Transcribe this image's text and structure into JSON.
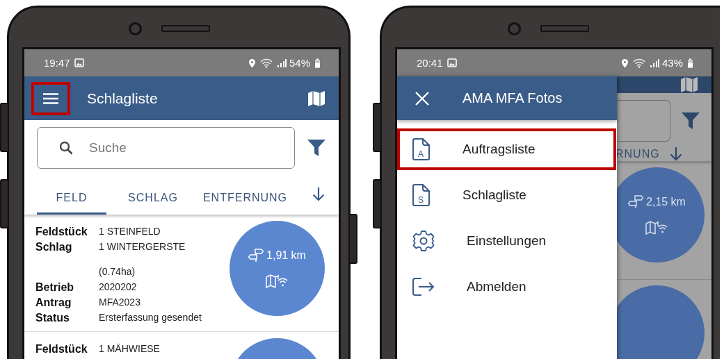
{
  "phones": [
    {
      "kind": "list",
      "status_bar": {
        "time": "19:47",
        "battery": "54%"
      },
      "app_bar": {
        "title": "Schlagliste",
        "menu_highlighted": true
      },
      "search": {
        "placeholder": "Suche"
      },
      "tabs": [
        {
          "label": "FELD",
          "selected": true
        },
        {
          "label": "SCHLAG",
          "selected": false
        },
        {
          "label": "ENTFERNUNG",
          "selected": false
        }
      ],
      "rows": [
        {
          "fields": [
            {
              "kind": "field",
              "label": "Feldstück",
              "value": "1 STEINFELD"
            },
            {
              "kind": "field",
              "label": "Schlag",
              "value": "1 WINTERGERSTE"
            },
            {
              "kind": "area",
              "value": "(0.74ha)"
            },
            {
              "kind": "field",
              "label": "Betrieb",
              "value": "2020202"
            },
            {
              "kind": "field",
              "label": "Antrag",
              "value": "MFA2023"
            },
            {
              "kind": "field",
              "label": "Status",
              "value": "Ersterfassung gesendet"
            }
          ],
          "distance": "1,91 km"
        },
        {
          "fields": [
            {
              "kind": "field",
              "label": "Feldstück",
              "value": "1 MÄHWIESE"
            }
          ]
        }
      ]
    },
    {
      "kind": "drawer",
      "status_bar": {
        "time": "20:41",
        "battery": "43%"
      },
      "drawer": {
        "title": "AMA MFA Fotos",
        "items": [
          {
            "kind": "document",
            "letter": "A",
            "label": "Auftragsliste",
            "highlighted": true
          },
          {
            "kind": "document",
            "letter": "S",
            "label": "Schlagliste",
            "highlighted": false
          },
          {
            "kind": "gear",
            "label": "Einstellungen",
            "highlighted": false
          },
          {
            "kind": "logout",
            "label": "Abmelden",
            "highlighted": false
          }
        ]
      },
      "background": {
        "tab_label": "RNUNG",
        "distance": "2,15 km"
      }
    }
  ]
}
